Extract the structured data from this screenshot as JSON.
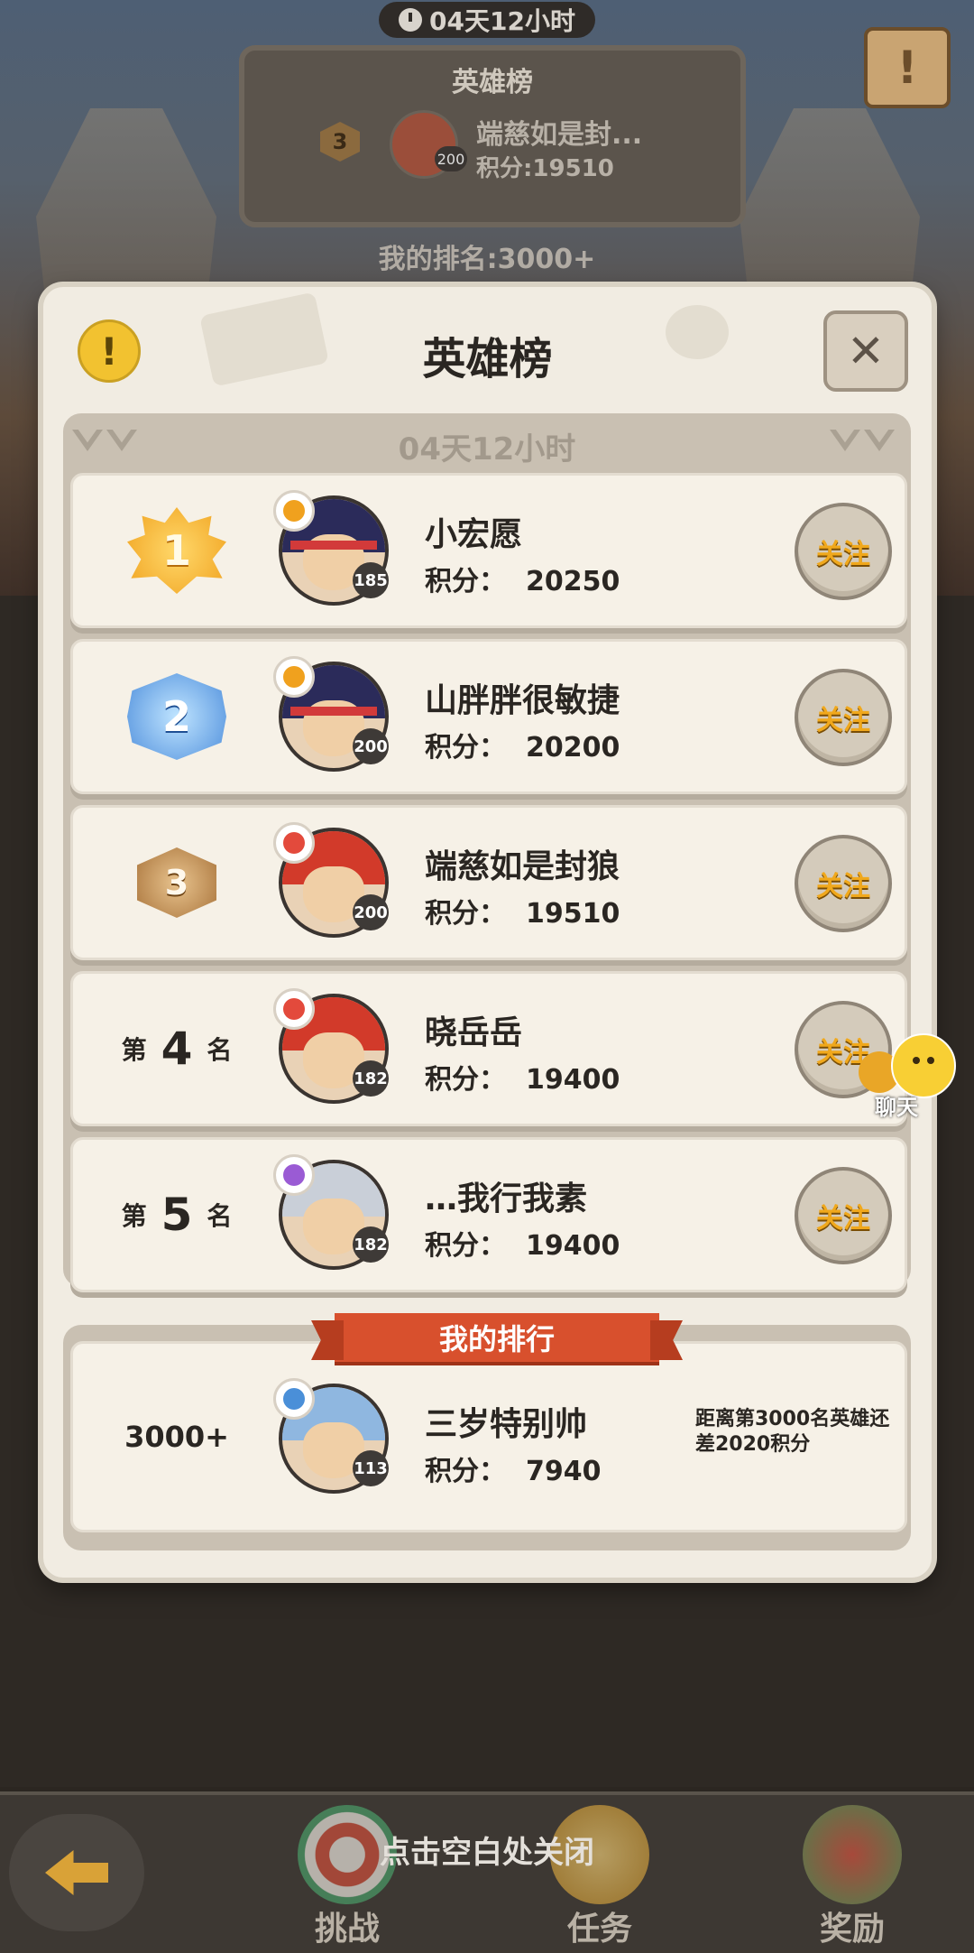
{
  "background": {
    "timer": "04天12小时",
    "board_title": "英雄榜",
    "top_rank": "3",
    "top_level": "200",
    "top_name": "端慈如是封...",
    "top_score": "积分:19510",
    "my_rank": "我的排名:3000+"
  },
  "dialog": {
    "title": "英雄榜",
    "timer": "04天12小时",
    "score_label": "积分：",
    "follow_label": "关注",
    "rank_prefix": "第",
    "rank_suffix": "名",
    "entries": [
      {
        "rank": "1",
        "name": "小宏愿",
        "score": "20250",
        "level": "185",
        "element_color": "#f0a11e",
        "hair_color": "#2b2b5a"
      },
      {
        "rank": "2",
        "name": "山胖胖很敏捷",
        "score": "20200",
        "level": "200",
        "element_color": "#f0a11e",
        "hair_color": "#2b2b5a"
      },
      {
        "rank": "3",
        "name": "端慈如是封狼",
        "score": "19510",
        "level": "200",
        "element_color": "#e34a3c",
        "hair_color": "#d23a2a"
      },
      {
        "rank": "4",
        "name": "晓岳岳",
        "score": "19400",
        "level": "182",
        "element_color": "#e34a3c",
        "hair_color": "#d23a2a"
      },
      {
        "rank": "5",
        "name": "…我行我素",
        "score": "19400",
        "level": "182",
        "element_color": "#9a5bd4",
        "hair_color": "#c9cfd8"
      }
    ],
    "my_section": {
      "ribbon": "我的排行",
      "rank": "3000+",
      "name": "三岁特别帅",
      "score": "7940",
      "level": "113",
      "element_color": "#4a8fd8",
      "hair_color": "#8fb7e0",
      "note": "距离第3000名英雄还差2020积分"
    }
  },
  "chat_label": "聊天",
  "close_hint": "点击空白处关闭",
  "nav": {
    "challenge": "挑战",
    "tasks": "任务",
    "rewards": "奖励"
  }
}
